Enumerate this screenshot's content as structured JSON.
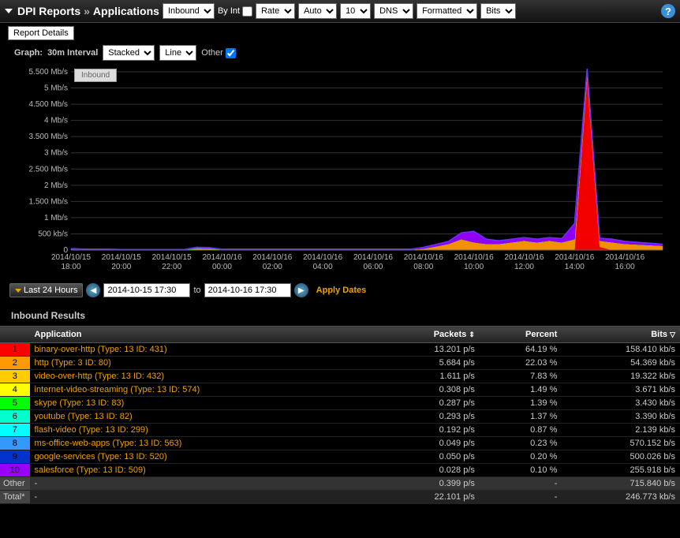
{
  "header": {
    "section": "DPI Reports",
    "page": "Applications",
    "selects": {
      "direction": "Inbound",
      "byint_label": "By Int",
      "rate": "Rate",
      "auto": "Auto",
      "top": "10",
      "dns": "DNS",
      "format": "Formatted",
      "units": "Bits"
    }
  },
  "report_details": "Report Details",
  "graph_controls": {
    "label": "Graph:",
    "interval": "30m Interval",
    "stack": "Stacked",
    "line": "Line",
    "other_label": "Other",
    "legend_badge": "Inbound"
  },
  "chart_data": {
    "type": "area",
    "title": "",
    "xlabel": "",
    "ylabel": "",
    "ylim": [
      0,
      5700000
    ],
    "y_ticks": [
      "0",
      "500 kb/s",
      "1 Mb/s",
      "1.500 Mb/s",
      "2 Mb/s",
      "2.500 Mb/s",
      "3 Mb/s",
      "3.500 Mb/s",
      "4 Mb/s",
      "4.500 Mb/s",
      "5 Mb/s",
      "5.500 Mb/s"
    ],
    "x_ticks": [
      "2014/10/15 18:00",
      "2014/10/15 20:00",
      "2014/10/15 22:00",
      "2014/10/16 00:00",
      "2014/10/16 02:00",
      "2014/10/16 04:00",
      "2014/10/16 06:00",
      "2014/10/16 08:00",
      "2014/10/16 10:00",
      "2014/10/16 12:00",
      "2014/10/16 14:00",
      "2014/10/16 16:00"
    ],
    "categories_per_tick": 4,
    "series": [
      {
        "name": "binary-over-http",
        "color": "#ff0000",
        "values": [
          0,
          0,
          0,
          0,
          0,
          0,
          0,
          0,
          0,
          0,
          0,
          0,
          0,
          0,
          0,
          0,
          0,
          0,
          0,
          0,
          0,
          0,
          0,
          0,
          0,
          0,
          0,
          0,
          0,
          0,
          0,
          0,
          0,
          0,
          0,
          0,
          0,
          0,
          0,
          0,
          0,
          5500000,
          100000,
          0,
          0,
          0,
          0,
          0
        ]
      },
      {
        "name": "http",
        "color": "#ff9900",
        "values": [
          30000,
          20000,
          20000,
          20000,
          10000,
          10000,
          10000,
          10000,
          10000,
          10000,
          30000,
          30000,
          20000,
          20000,
          20000,
          20000,
          20000,
          20000,
          20000,
          20000,
          20000,
          20000,
          20000,
          20000,
          20000,
          20000,
          20000,
          20000,
          50000,
          120000,
          200000,
          350000,
          250000,
          200000,
          200000,
          250000,
          300000,
          250000,
          300000,
          250000,
          350000,
          200000,
          200000,
          250000,
          200000,
          180000,
          160000,
          140000
        ]
      },
      {
        "name": "video-over-http",
        "color": "#ffff00",
        "values": [
          0,
          0,
          0,
          0,
          0,
          0,
          0,
          0,
          0,
          0,
          0,
          0,
          0,
          0,
          0,
          0,
          0,
          0,
          0,
          0,
          0,
          0,
          0,
          0,
          0,
          0,
          0,
          0,
          0,
          0,
          0,
          0,
          0,
          0,
          0,
          0,
          0,
          0,
          0,
          0,
          0,
          0,
          0,
          0,
          0,
          0,
          0,
          0
        ]
      },
      {
        "name": "internet-video-streaming",
        "color": "#00ff00",
        "values": [
          0,
          0,
          0,
          0,
          0,
          0,
          0,
          0,
          0,
          0,
          40000,
          30000,
          0,
          0,
          0,
          0,
          0,
          0,
          0,
          0,
          0,
          0,
          0,
          0,
          0,
          0,
          0,
          0,
          0,
          0,
          0,
          0,
          0,
          0,
          0,
          0,
          0,
          0,
          0,
          0,
          0,
          0,
          0,
          0,
          0,
          0,
          0,
          0
        ]
      },
      {
        "name": "skype",
        "color": "#00ffcc",
        "values": [
          0,
          0,
          0,
          0,
          0,
          0,
          0,
          0,
          0,
          0,
          0,
          0,
          0,
          0,
          0,
          0,
          0,
          0,
          0,
          0,
          0,
          0,
          0,
          0,
          0,
          0,
          0,
          0,
          0,
          0,
          0,
          0,
          0,
          0,
          0,
          0,
          0,
          0,
          0,
          0,
          0,
          0,
          0,
          0,
          0,
          0,
          0,
          0
        ]
      },
      {
        "name": "youtube",
        "color": "#00ccff",
        "values": [
          0,
          0,
          0,
          0,
          0,
          0,
          0,
          0,
          0,
          0,
          0,
          0,
          0,
          0,
          0,
          0,
          0,
          0,
          0,
          0,
          0,
          0,
          0,
          0,
          0,
          0,
          0,
          0,
          0,
          0,
          0,
          0,
          0,
          0,
          0,
          0,
          0,
          0,
          0,
          0,
          0,
          0,
          0,
          0,
          0,
          0,
          0,
          0
        ]
      },
      {
        "name": "flash-video",
        "color": "#3399ff",
        "values": [
          0,
          0,
          0,
          0,
          0,
          0,
          0,
          0,
          0,
          0,
          0,
          0,
          0,
          0,
          0,
          0,
          0,
          0,
          0,
          0,
          0,
          0,
          0,
          0,
          0,
          0,
          0,
          0,
          0,
          0,
          0,
          0,
          0,
          0,
          0,
          0,
          0,
          0,
          0,
          0,
          0,
          0,
          0,
          0,
          0,
          0,
          0,
          0
        ]
      },
      {
        "name": "ms-office-web-apps",
        "color": "#0066ff",
        "values": [
          0,
          0,
          0,
          0,
          0,
          0,
          0,
          0,
          0,
          0,
          0,
          0,
          0,
          0,
          0,
          0,
          0,
          0,
          0,
          0,
          0,
          0,
          0,
          0,
          0,
          0,
          0,
          0,
          0,
          0,
          0,
          0,
          0,
          0,
          0,
          0,
          0,
          0,
          0,
          0,
          0,
          0,
          0,
          0,
          0,
          0,
          0,
          0
        ]
      },
      {
        "name": "google-services",
        "color": "#0033cc",
        "values": [
          0,
          0,
          0,
          0,
          0,
          0,
          0,
          0,
          0,
          0,
          0,
          0,
          0,
          0,
          0,
          0,
          0,
          0,
          0,
          0,
          0,
          0,
          0,
          0,
          0,
          0,
          0,
          0,
          0,
          0,
          0,
          0,
          0,
          0,
          0,
          0,
          0,
          0,
          0,
          0,
          0,
          0,
          0,
          0,
          0,
          0,
          0,
          0
        ]
      },
      {
        "name": "salesforce",
        "color": "#9900ff",
        "values": [
          20000,
          10000,
          10000,
          10000,
          10000,
          10000,
          10000,
          10000,
          10000,
          10000,
          20000,
          20000,
          10000,
          10000,
          10000,
          10000,
          10000,
          10000,
          10000,
          10000,
          10000,
          10000,
          10000,
          10000,
          10000,
          10000,
          10000,
          10000,
          40000,
          60000,
          80000,
          200000,
          350000,
          150000,
          100000,
          100000,
          100000,
          100000,
          100000,
          120000,
          500000,
          100000,
          80000,
          100000,
          80000,
          70000,
          60000,
          50000
        ]
      }
    ]
  },
  "time": {
    "range_label": "Last 24 Hours",
    "from": "2014-10-15 17:30",
    "to_label": "to",
    "to": "2014-10-16 17:30",
    "apply": "Apply Dates"
  },
  "results": {
    "title": "Inbound Results",
    "columns": {
      "app": "Application",
      "packets": "Packets",
      "percent": "Percent",
      "bits": "Bits"
    },
    "rows": [
      {
        "rank": "1",
        "color": "#ff0000",
        "app": "binary-over-http (Type: 13 ID: 431)",
        "packets": "13.201 p/s",
        "percent": "64.19 %",
        "bits": "158.410 kb/s"
      },
      {
        "rank": "2",
        "color": "#ff9900",
        "app": "http (Type: 3 ID: 80)",
        "packets": "5.684 p/s",
        "percent": "22.03 %",
        "bits": "54.369 kb/s"
      },
      {
        "rank": "3",
        "color": "#ffcc00",
        "app": "video-over-http (Type: 13 ID: 432)",
        "packets": "1.611 p/s",
        "percent": "7.83 %",
        "bits": "19.322 kb/s"
      },
      {
        "rank": "4",
        "color": "#ffff00",
        "app": "internet-video-streaming (Type: 13 ID: 574)",
        "packets": "0.308 p/s",
        "percent": "1.49 %",
        "bits": "3.671 kb/s"
      },
      {
        "rank": "5",
        "color": "#00ff00",
        "app": "skype (Type: 13 ID: 83)",
        "packets": "0.287 p/s",
        "percent": "1.39 %",
        "bits": "3.430 kb/s"
      },
      {
        "rank": "6",
        "color": "#00ffcc",
        "app": "youtube (Type: 13 ID: 82)",
        "packets": "0.293 p/s",
        "percent": "1.37 %",
        "bits": "3.390 kb/s"
      },
      {
        "rank": "7",
        "color": "#00ffff",
        "app": "flash-video (Type: 13 ID: 299)",
        "packets": "0.192 p/s",
        "percent": "0.87 %",
        "bits": "2.139 kb/s"
      },
      {
        "rank": "8",
        "color": "#3399ff",
        "app": "ms-office-web-apps (Type: 13 ID: 563)",
        "packets": "0.049 p/s",
        "percent": "0.23 %",
        "bits": "570.152 b/s"
      },
      {
        "rank": "9",
        "color": "#0033cc",
        "app": "google-services (Type: 13 ID: 520)",
        "packets": "0.050 p/s",
        "percent": "0.20 %",
        "bits": "500.026 b/s"
      },
      {
        "rank": "10",
        "color": "#9900ff",
        "app": "salesforce (Type: 13 ID: 509)",
        "packets": "0.028 p/s",
        "percent": "0.10 %",
        "bits": "255.918 b/s"
      }
    ],
    "other": {
      "label": "Other",
      "app": "-",
      "packets": "0.399 p/s",
      "percent": "-",
      "bits": "715.840 b/s"
    },
    "total": {
      "label": "Total*",
      "app": "-",
      "packets": "22.101 p/s",
      "percent": "-",
      "bits": "246.773 kb/s"
    }
  }
}
